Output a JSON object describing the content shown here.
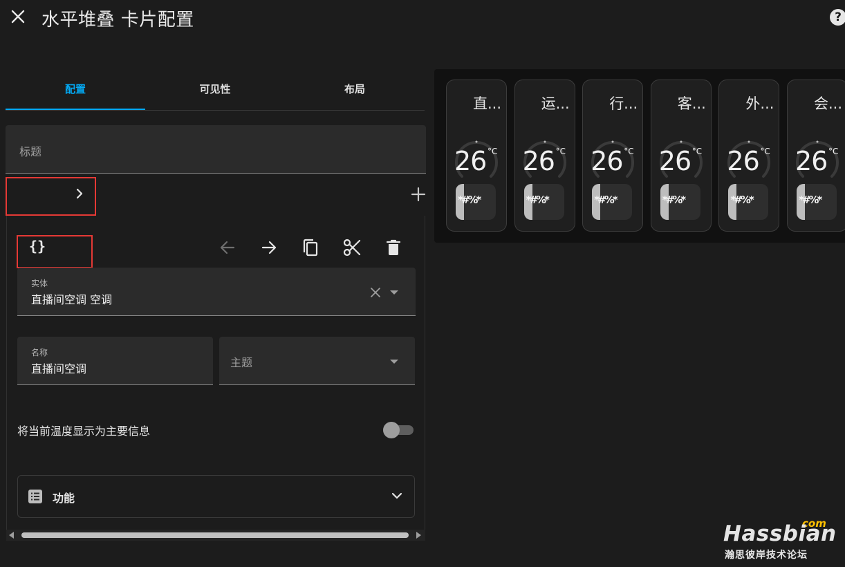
{
  "window": {
    "title": "水平堆叠 卡片配置"
  },
  "tabs": [
    {
      "label": "配置",
      "active": true
    },
    {
      "label": "可见性",
      "active": false
    },
    {
      "label": "布局",
      "active": false
    }
  ],
  "title_field": {
    "placeholder": "标题"
  },
  "editor": {
    "code_icon": "{}",
    "toolbar_icons": [
      "arrow-left-icon",
      "arrow-right-icon",
      "copy-icon",
      "cut-icon",
      "delete-icon"
    ],
    "entity": {
      "label": "实体",
      "value": "直播间空调 空调"
    },
    "name": {
      "label": "名称",
      "value": "直播间空调"
    },
    "theme": {
      "placeholder": "主题"
    },
    "toggle": {
      "label": "将当前温度显示为主要信息",
      "on": false
    },
    "features": {
      "label": "功能"
    }
  },
  "preview": {
    "tiles": [
      {
        "name": "直...",
        "temp": "26",
        "unit": "°C",
        "modes": "*#%*"
      },
      {
        "name": "运...",
        "temp": "26",
        "unit": "°C",
        "modes": "*#%*"
      },
      {
        "name": "行...",
        "temp": "26",
        "unit": "°C",
        "modes": "*#%*"
      },
      {
        "name": "客...",
        "temp": "26",
        "unit": "°C",
        "modes": "*#%*"
      },
      {
        "name": "外...",
        "temp": "26",
        "unit": "°C",
        "modes": "*#%*"
      },
      {
        "name": "会...",
        "temp": "26",
        "unit": "°C",
        "modes": "*#%*"
      }
    ]
  },
  "watermark": {
    "com": "com",
    "brand": "Hassbian",
    "sub": "瀚思彼岸技术论坛"
  },
  "colors": {
    "accent": "#03a9f4",
    "highlight_box": "#e53935",
    "background": "#1c1c1c"
  }
}
